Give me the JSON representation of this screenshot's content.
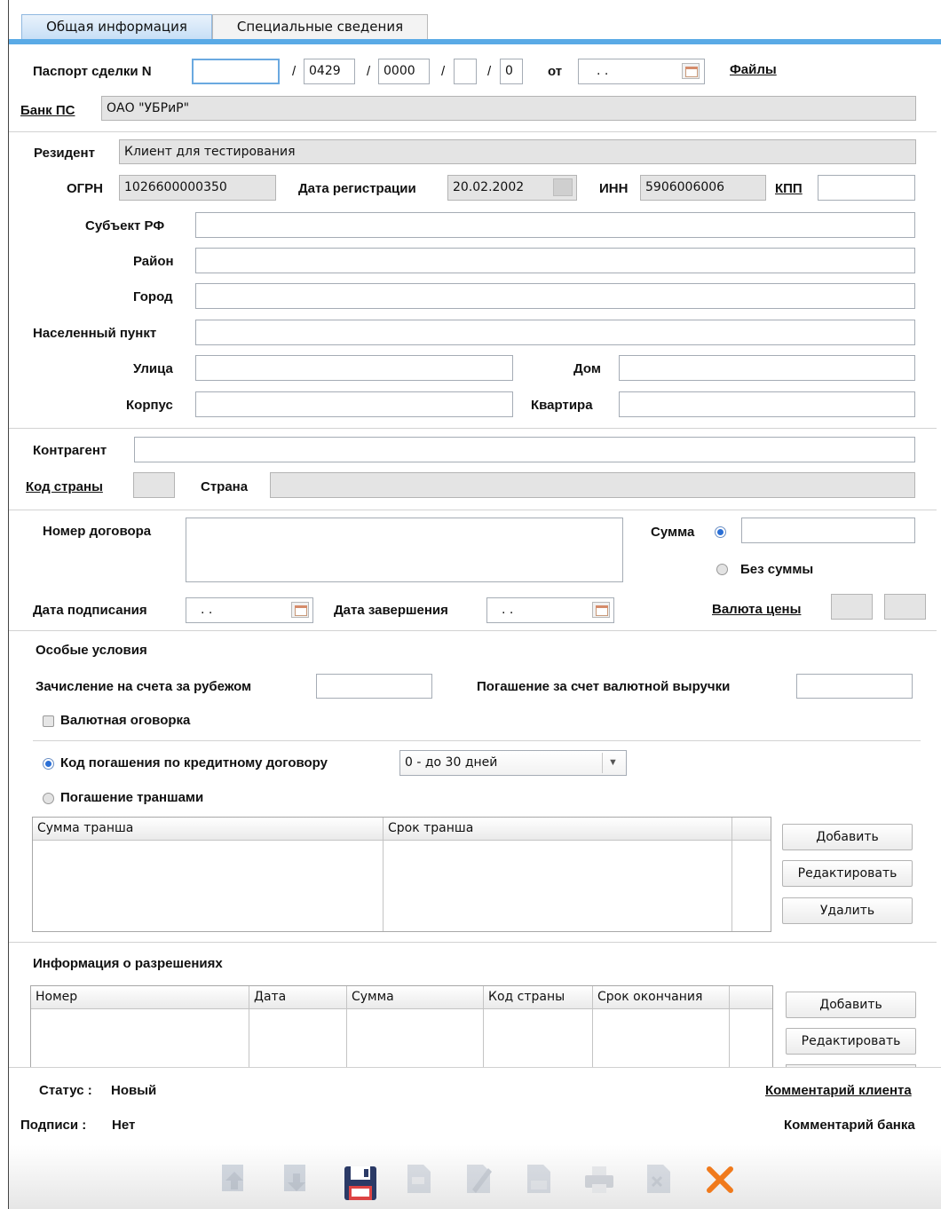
{
  "tabs": [
    "Общая информация",
    "Специальные сведения"
  ],
  "passport": {
    "label": "Паспорт сделки N",
    "n1": "",
    "n2": "0429",
    "n3": "0000",
    "n4": "",
    "n5": "0",
    "from_label": "от",
    "date": " .  .",
    "files_link": "Файлы"
  },
  "bank": {
    "label": "Банк ПС",
    "value": "ОАО \"УБРиР\""
  },
  "resident": {
    "label": "Резидент",
    "value": "Клиент для тестирования",
    "ogrn_label": "ОГРН",
    "ogrn": "1026600000350",
    "regdate_label": "Дата регистрации",
    "regdate": "20.02.2002",
    "inn_label": "ИНН",
    "inn": "5906006006",
    "kpp_label": "КПП",
    "kpp": ""
  },
  "address": {
    "subject_label": "Субъект РФ",
    "district_label": "Район",
    "city_label": "Город",
    "locality_label": "Населенный пункт",
    "street_label": "Улица",
    "house_label": "Дом",
    "building_label": "Корпус",
    "apartment_label": "Квартира"
  },
  "counterparty": {
    "label": "Контрагент",
    "country_code_label": "Код страны",
    "country_label": "Страна"
  },
  "contract": {
    "number_label": "Номер договора",
    "sum_label": "Сумма",
    "no_sum_label": "Без суммы",
    "sign_date_label": "Дата подписания",
    "sign_date": " .  .",
    "end_date_label": "Дата завершения",
    "end_date": " .  .",
    "currency_label": "Валюта цены"
  },
  "conditions": {
    "title": "Особые условия",
    "abroad_label": "Зачисление на счета за рубежом",
    "repay_label": "Погашение за счет валютной выручки",
    "currency_clause": "Валютная оговорка",
    "credit_code_label": "Код погашения по кредитному договору",
    "credit_code_value": "0 - до 30 дней",
    "tranches_label": "Погашение траншами"
  },
  "tranche_table": {
    "columns": [
      "Сумма транша",
      "Срок транша"
    ],
    "buttons": [
      "Добавить",
      "Редактировать",
      "Удалить"
    ]
  },
  "permissions": {
    "title": "Информация о разрешениях",
    "columns": [
      "Номер",
      "Дата",
      "Сумма",
      "Код страны",
      "Срок окончания"
    ],
    "buttons": [
      "Добавить",
      "Редактировать"
    ]
  },
  "status": {
    "label": "Статус :",
    "value": "Новый",
    "signs_label": "Подписи :",
    "signs_value": "Нет",
    "client_comment": "Комментарий клиента",
    "bank_comment": "Комментарий банка"
  },
  "toolbar": {
    "icons": [
      "move-up-icon",
      "move-down-icon",
      "save-icon",
      "export-icon",
      "edit-icon",
      "document-icon",
      "print-icon",
      "delete-icon",
      "close-icon"
    ]
  },
  "colors": {
    "accent": "#5aaae6",
    "close": "#f07a1c",
    "save": "#2b3a66"
  }
}
